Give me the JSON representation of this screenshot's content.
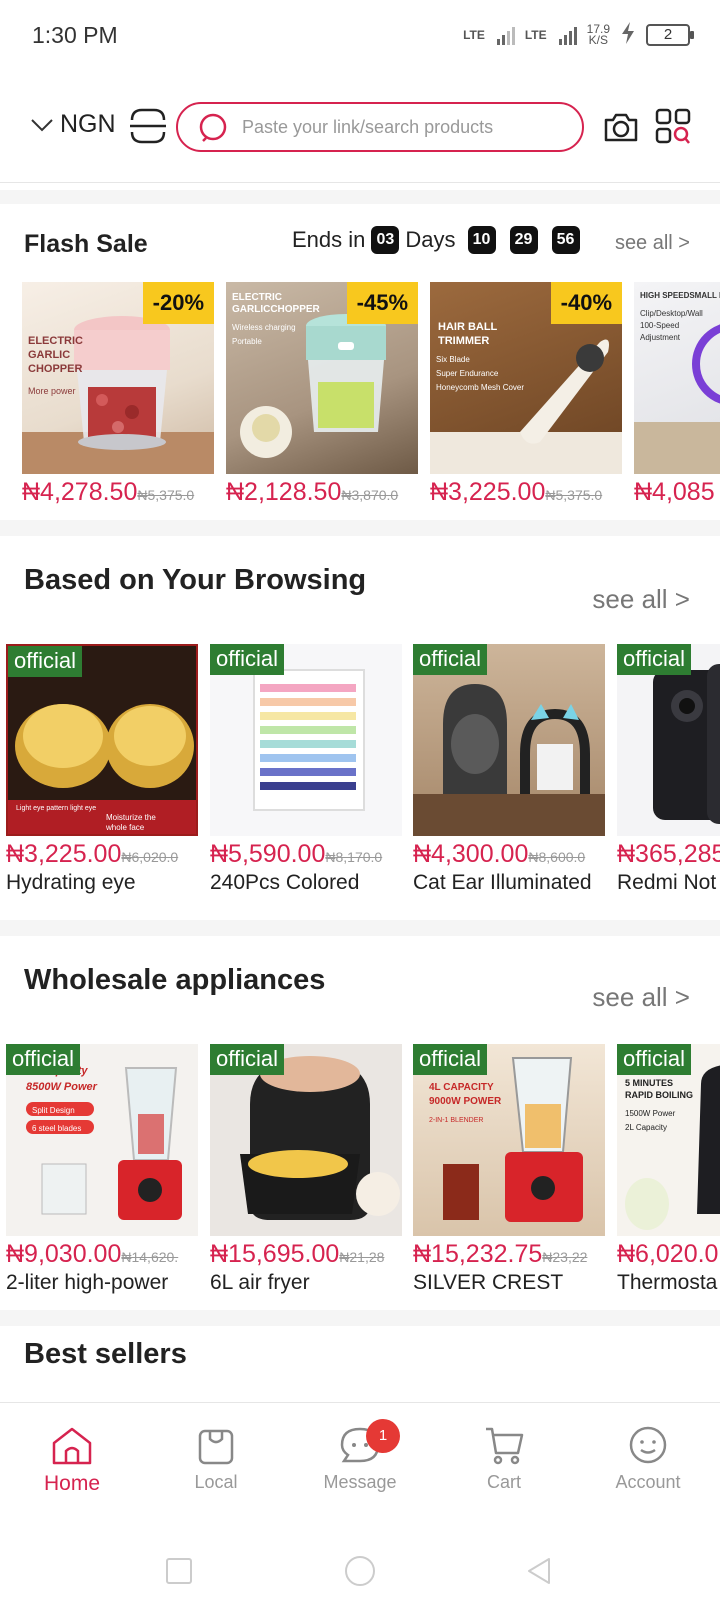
{
  "status": {
    "time": "1:30 PM",
    "lte1": "LTE",
    "lte2": "LTE",
    "speed_value": "17.9",
    "speed_unit": "K/S",
    "battery": "2"
  },
  "header": {
    "currency": "NGN",
    "search_placeholder": "Paste your link/search products"
  },
  "flash_sale": {
    "title": "Flash Sale",
    "ends_in": "Ends in",
    "days_count": "03",
    "days_label": "Days",
    "hours": "10",
    "minutes": "29",
    "seconds": "56",
    "see_all": "see all >",
    "products": [
      {
        "discount": "-20%",
        "price": "₦4,278.50",
        "original": "₦5,375.0",
        "thumb_text": "ELECTRIC GARLIC CHOPPER",
        "thumb_sub": "More power"
      },
      {
        "discount": "-45%",
        "price": "₦2,128.50",
        "original": "₦3,870.0",
        "thumb_text": "ELECTRIC GARLICCHOPPER",
        "thumb_sub": "Wireless charging · Portable"
      },
      {
        "discount": "-40%",
        "price": "₦3,225.00",
        "original": "₦5,375.0",
        "thumb_text": "HAIR BALL TRIMMER",
        "thumb_sub": "Six Blade · Super Endurance · Honeycomb Mesh Cover"
      },
      {
        "price": "₦4,085",
        "thumb_text": "HIGH SPEEDSMALL FA",
        "thumb_sub": "Clip/Desktop/Wall · 100-Speed · Adjustment"
      }
    ]
  },
  "browsing": {
    "title": "Based on Your Browsing",
    "see_all": "see all >",
    "badge": "official",
    "products": [
      {
        "price": "₦3,225.00",
        "original": "₦6,020.0",
        "name": "Hydrating eye"
      },
      {
        "price": "₦5,590.00",
        "original": "₦8,170.0",
        "name": "240Pcs Colored"
      },
      {
        "price": "₦4,300.00",
        "original": "₦8,600.0",
        "name": "Cat Ear Illuminated"
      },
      {
        "price": "₦365,285",
        "original": "",
        "name": "Redmi Not"
      }
    ]
  },
  "wholesale": {
    "title": "Wholesale appliances",
    "see_all": "see all >",
    "badge": "official",
    "products": [
      {
        "price": "₦9,030.00",
        "original": "₦14,620.",
        "name": "2-liter high-power",
        "thumb_text": "2L Capacity 8500W Power"
      },
      {
        "price": "₦15,695.00",
        "original": "₦21,28",
        "name": "6L air fryer",
        "thumb_text": ""
      },
      {
        "price": "₦15,232.75",
        "original": "₦23,22",
        "name": "SILVER CREST",
        "thumb_text": "4L CAPACITY 9000W POWER"
      },
      {
        "price": "₦6,020.0",
        "original": "",
        "name": "Thermosta",
        "thumb_text": "5 MINUTES RAPID BOILING"
      }
    ]
  },
  "best_sellers": {
    "title": "Best sellers"
  },
  "nav": {
    "home": "Home",
    "local": "Local",
    "message": "Message",
    "message_badge": "1",
    "cart": "Cart",
    "account": "Account"
  },
  "colors": {
    "accent": "#d6234f",
    "official": "#2e7d32",
    "discount": "#f8c81e"
  },
  "icons": [
    "search-icon",
    "camera-icon",
    "scan-icon",
    "menu-icon",
    "home-icon",
    "bag-icon",
    "chat-icon",
    "cart-icon",
    "smile-icon"
  ]
}
